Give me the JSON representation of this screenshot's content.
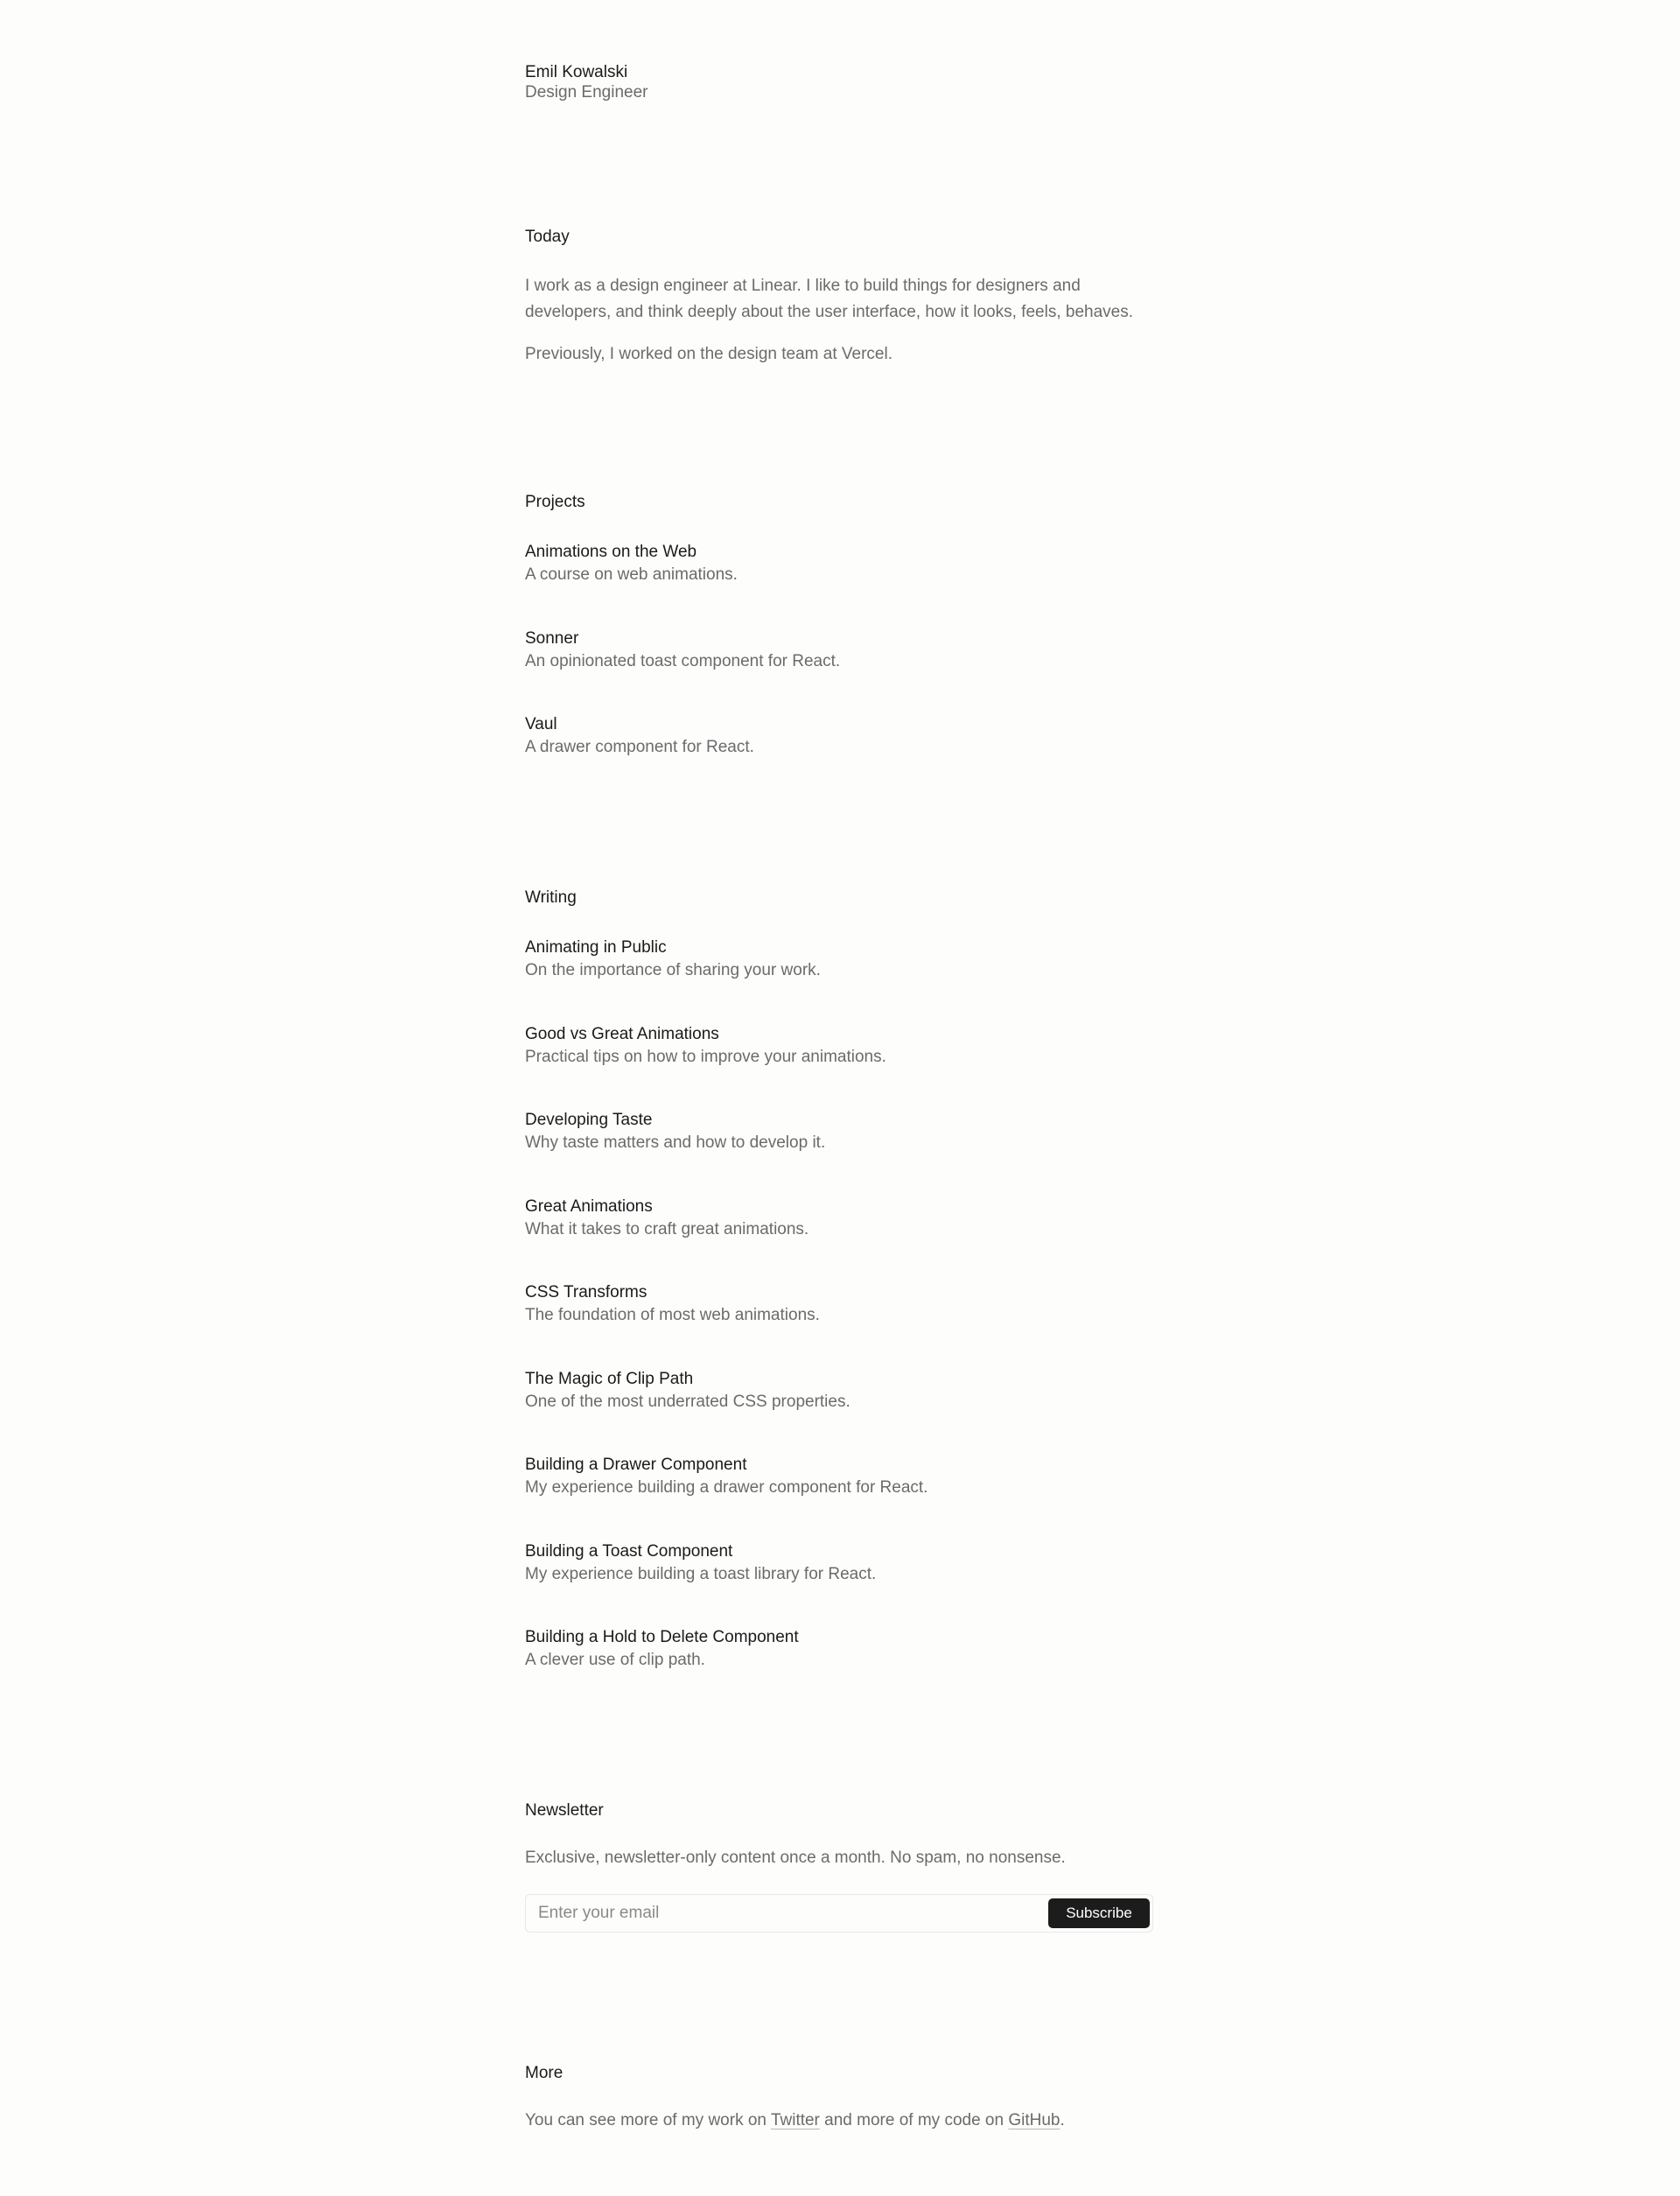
{
  "header": {
    "name": "Emil Kowalski",
    "role": "Design Engineer"
  },
  "today": {
    "title": "Today",
    "paragraph1": "I work as a design engineer at Linear. I like to build things for designers and developers, and think deeply about the user interface, how it looks, feels, behaves.",
    "paragraph2": "Previously, I worked on the design team at Vercel."
  },
  "projects": {
    "title": "Projects",
    "items": [
      {
        "title": "Animations on the Web",
        "description": "A course on web animations."
      },
      {
        "title": "Sonner",
        "description": "An opinionated toast component for React."
      },
      {
        "title": "Vaul",
        "description": "A drawer component for React."
      }
    ]
  },
  "writing": {
    "title": "Writing",
    "items": [
      {
        "title": "Animating in Public",
        "description": "On the importance of sharing your work."
      },
      {
        "title": "Good vs Great Animations",
        "description": "Practical tips on how to improve your animations."
      },
      {
        "title": "Developing Taste",
        "description": "Why taste matters and how to develop it."
      },
      {
        "title": "Great Animations",
        "description": "What it takes to craft great animations."
      },
      {
        "title": "CSS Transforms",
        "description": "The foundation of most web animations."
      },
      {
        "title": "The Magic of Clip Path",
        "description": "One of the most underrated CSS properties."
      },
      {
        "title": "Building a Drawer Component",
        "description": "My experience building a drawer component for React."
      },
      {
        "title": "Building a Toast Component",
        "description": "My experience building a toast library for React."
      },
      {
        "title": "Building a Hold to Delete Component",
        "description": "A clever use of clip path."
      }
    ]
  },
  "newsletter": {
    "title": "Newsletter",
    "description": "Exclusive, newsletter-only content once a month. No spam, no nonsense.",
    "email_value": "",
    "email_placeholder": "Enter your email",
    "subscribe_label": "Subscribe"
  },
  "more": {
    "title": "More",
    "text_before": "You can see more of my work on ",
    "twitter_label": "Twitter",
    "text_middle": " and more of my code on ",
    "github_label": "GitHub",
    "text_after": "."
  },
  "colors": {
    "background": "#fdfdfc",
    "heading": "#1a1a1a",
    "body": "#6b6b6b",
    "button": "#1c1c1c"
  }
}
